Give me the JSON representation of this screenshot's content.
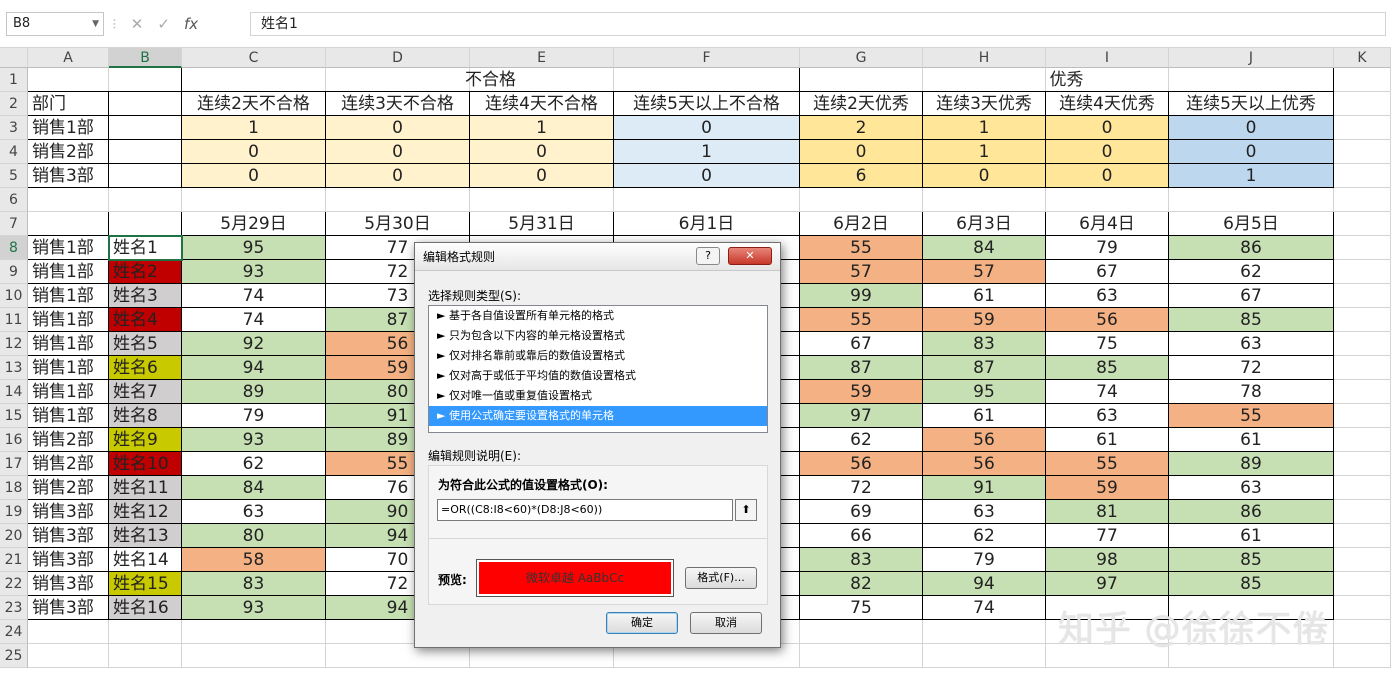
{
  "formula_bar": {
    "name_box": "B8",
    "cancel_glyph": "✕",
    "enter_glyph": "✓",
    "fx_glyph": "fx",
    "content": "姓名1"
  },
  "columns": [
    "A",
    "B",
    "C",
    "D",
    "E",
    "F",
    "G",
    "H",
    "I",
    "J",
    "K"
  ],
  "row_numbers": [
    "1",
    "2",
    "3",
    "4",
    "5",
    "6",
    "7",
    "8",
    "9",
    "10",
    "11",
    "12",
    "13",
    "14",
    "15",
    "16",
    "17",
    "18",
    "19",
    "20",
    "21",
    "22",
    "23",
    "24",
    "25"
  ],
  "summary": {
    "group_fail": "不合格",
    "group_excellent": "优秀",
    "dept_header": "部门",
    "headers": [
      "连续2天不合格",
      "连续3天不合格",
      "连续4天不合格",
      "连续5天以上不合格",
      "连续2天优秀",
      "连续3天优秀",
      "连续4天优秀",
      "连续5天以上优秀"
    ],
    "rows": [
      {
        "dept": "销售1部",
        "values": [
          "1",
          "0",
          "1",
          "0",
          "2",
          "1",
          "0",
          "0"
        ]
      },
      {
        "dept": "销售2部",
        "values": [
          "0",
          "0",
          "0",
          "1",
          "0",
          "1",
          "0",
          "0"
        ]
      },
      {
        "dept": "销售3部",
        "values": [
          "0",
          "0",
          "0",
          "0",
          "6",
          "0",
          "0",
          "1"
        ]
      }
    ],
    "colors": [
      "#fff2cc",
      "#fff2cc",
      "#fff2cc",
      "#ddebf7",
      "#ffe699",
      "#ffe699",
      "#ffe699",
      "#bdd7ee"
    ]
  },
  "dates": [
    "5月29日",
    "5月30日",
    "5月31日",
    "6月1日",
    "6月2日",
    "6月3日",
    "6月4日",
    "6月5日"
  ],
  "detail_rows": [
    {
      "dept": "销售1部",
      "name": "姓名1",
      "c": "95",
      "d": "77",
      "e": "",
      "f": "",
      "g": "55",
      "h": "84",
      "i": "79",
      "j": "86"
    },
    {
      "dept": "销售1部",
      "name": "姓名2",
      "c": "93",
      "d": "72",
      "e": "",
      "f": "",
      "g": "57",
      "h": "57",
      "i": "67",
      "j": "62"
    },
    {
      "dept": "销售1部",
      "name": "姓名3",
      "c": "74",
      "d": "73",
      "e": "",
      "f": "",
      "g": "99",
      "h": "61",
      "i": "63",
      "j": "67"
    },
    {
      "dept": "销售1部",
      "name": "姓名4",
      "c": "74",
      "d": "87",
      "e": "",
      "f": "",
      "g": "55",
      "h": "59",
      "i": "56",
      "j": "85"
    },
    {
      "dept": "销售1部",
      "name": "姓名5",
      "c": "92",
      "d": "56",
      "e": "",
      "f": "",
      "g": "67",
      "h": "83",
      "i": "75",
      "j": "63"
    },
    {
      "dept": "销售1部",
      "name": "姓名6",
      "c": "94",
      "d": "59",
      "e": "",
      "f": "",
      "g": "87",
      "h": "87",
      "i": "85",
      "j": "72"
    },
    {
      "dept": "销售1部",
      "name": "姓名7",
      "c": "89",
      "d": "80",
      "e": "",
      "f": "",
      "g": "59",
      "h": "95",
      "i": "74",
      "j": "78"
    },
    {
      "dept": "销售1部",
      "name": "姓名8",
      "c": "79",
      "d": "91",
      "e": "",
      "f": "",
      "g": "97",
      "h": "61",
      "i": "63",
      "j": "55"
    },
    {
      "dept": "销售2部",
      "name": "姓名9",
      "c": "93",
      "d": "89",
      "e": "",
      "f": "",
      "g": "62",
      "h": "56",
      "i": "61",
      "j": "61"
    },
    {
      "dept": "销售2部",
      "name": "姓名10",
      "c": "62",
      "d": "55",
      "e": "",
      "f": "",
      "g": "56",
      "h": "56",
      "i": "55",
      "j": "89"
    },
    {
      "dept": "销售2部",
      "name": "姓名11",
      "c": "84",
      "d": "76",
      "e": "",
      "f": "",
      "g": "72",
      "h": "91",
      "i": "59",
      "j": "63"
    },
    {
      "dept": "销售3部",
      "name": "姓名12",
      "c": "63",
      "d": "90",
      "e": "",
      "f": "",
      "g": "69",
      "h": "63",
      "i": "81",
      "j": "86"
    },
    {
      "dept": "销售3部",
      "name": "姓名13",
      "c": "80",
      "d": "94",
      "e": "",
      "f": "",
      "g": "66",
      "h": "62",
      "i": "77",
      "j": "61"
    },
    {
      "dept": "销售3部",
      "name": "姓名14",
      "c": "58",
      "d": "70",
      "e": "",
      "f": "",
      "g": "83",
      "h": "79",
      "i": "98",
      "j": "85"
    },
    {
      "dept": "销售3部",
      "name": "姓名15",
      "c": "83",
      "d": "72",
      "e": "",
      "f": "",
      "g": "82",
      "h": "94",
      "i": "97",
      "j": "85"
    },
    {
      "dept": "销售3部",
      "name": "姓名16",
      "c": "93",
      "d": "94",
      "e": "",
      "f": "",
      "g": "75",
      "h": "74",
      "i": "",
      "j": ""
    }
  ],
  "name_fill_colors": {
    "姓名2": "#c00000",
    "姓名4": "#c00000",
    "姓名10": "#c00000",
    "姓名3": "#d0cece",
    "姓名5": "#d0cece",
    "姓名7": "#d0cece",
    "姓名8": "#d0cece",
    "姓名11": "#d0cece",
    "姓名12": "#d0cece",
    "姓名13": "#d0cece",
    "姓名16": "#d0cece",
    "姓名6": "#c9c900",
    "姓名9": "#c9c900",
    "姓名15": "#c9c900"
  },
  "cell_colors": {
    "green": "#c6e0b4",
    "orange": "#f4b183"
  },
  "dialog": {
    "title": "编辑格式规则",
    "help_glyph": "?",
    "close_glyph": "✕",
    "rule_type_label": "选择规则类型(S):",
    "rule_types": [
      "► 基于各自值设置所有单元格的格式",
      "► 只为包含以下内容的单元格设置格式",
      "► 仅对排名靠前或靠后的数值设置格式",
      "► 仅对高于或低于平均值的数值设置格式",
      "► 仅对唯一值或重复值设置格式",
      "► 使用公式确定要设置格式的单元格"
    ],
    "selected_rule_index": 5,
    "desc_label": "编辑规则说明(E):",
    "formula_label": "为符合此公式的值设置格式(O):",
    "formula": "=OR((C8:I8<60)*(D8:J8<60))",
    "up_glyph": "⬆",
    "preview_label": "预览:",
    "preview_text": "微软卓越  AaBbCc",
    "preview_color": "#ff0000",
    "format_button": "格式(F)...",
    "ok_button": "确定",
    "cancel_button": "取消"
  },
  "watermark": "知乎 @徐徐不倦"
}
